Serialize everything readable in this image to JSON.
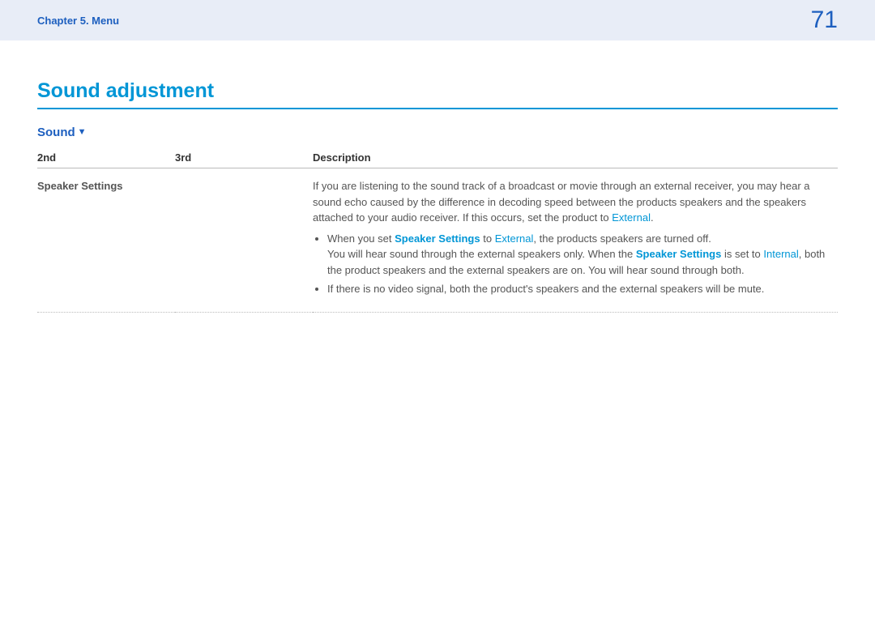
{
  "header": {
    "breadcrumb": "Chapter 5.  Menu",
    "page_number": "71"
  },
  "title": "Sound adjustment",
  "section": {
    "label": "Sound",
    "arrow": "▼"
  },
  "table": {
    "headers": {
      "c1": "2nd",
      "c2": "3rd",
      "c3": "Description"
    },
    "row": {
      "second": "Speaker Settings",
      "third": "",
      "desc": {
        "p1_a": "If you are listening to the sound track of a broadcast or movie through an external receiver, you may hear a sound echo caused by the difference in decoding speed between the products speakers and the speakers attached to your audio receiver. If this occurs, set the product to ",
        "external": "External",
        "p1_b": ".",
        "b1_a": "When you set ",
        "b1_ss": "Speaker Settings",
        "b1_b": " to ",
        "b1_ext": "External",
        "b1_c": ", the products speakers are turned off.",
        "b1_d": "You will hear sound through the external speakers only. When the ",
        "b1_ss2": "Speaker Settings",
        "b1_e": " is set to ",
        "b1_int": "Internal",
        "b1_f": ", both the product speakers and the external speakers are on. You will hear sound through both.",
        "b2": "If there is no video signal, both the product's speakers and the external speakers will be mute."
      }
    }
  }
}
